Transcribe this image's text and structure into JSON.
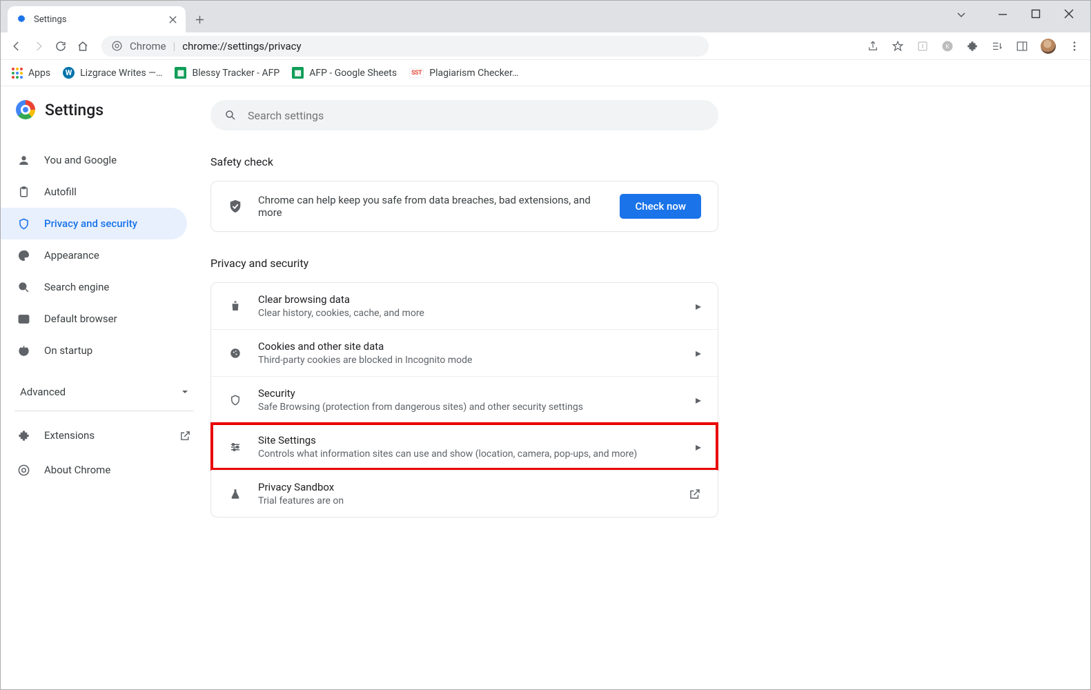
{
  "window": {
    "tab_title": "Settings",
    "address_label": "Chrome",
    "address_url": "chrome://settings/privacy"
  },
  "bookmarks": {
    "apps": "Apps",
    "items": [
      "Lizgrace Writes —…",
      "Blessy Tracker - AFP",
      "AFP - Google Sheets",
      "Plagiarism Checker…"
    ]
  },
  "header": {
    "title": "Settings"
  },
  "search": {
    "placeholder": "Search settings"
  },
  "nav": {
    "items": [
      "You and Google",
      "Autofill",
      "Privacy and security",
      "Appearance",
      "Search engine",
      "Default browser",
      "On startup"
    ],
    "advanced": "Advanced",
    "extensions": "Extensions",
    "about": "About Chrome"
  },
  "safety": {
    "section": "Safety check",
    "text": "Chrome can help keep you safe from data breaches, bad extensions, and more",
    "button": "Check now"
  },
  "privacy": {
    "section": "Privacy and security",
    "rows": [
      {
        "t": "Clear browsing data",
        "s": "Clear history, cookies, cache, and more"
      },
      {
        "t": "Cookies and other site data",
        "s": "Third-party cookies are blocked in Incognito mode"
      },
      {
        "t": "Security",
        "s": "Safe Browsing (protection from dangerous sites) and other security settings"
      },
      {
        "t": "Site Settings",
        "s": "Controls what information sites can use and show (location, camera, pop-ups, and more)"
      },
      {
        "t": "Privacy Sandbox",
        "s": "Trial features are on"
      }
    ]
  }
}
